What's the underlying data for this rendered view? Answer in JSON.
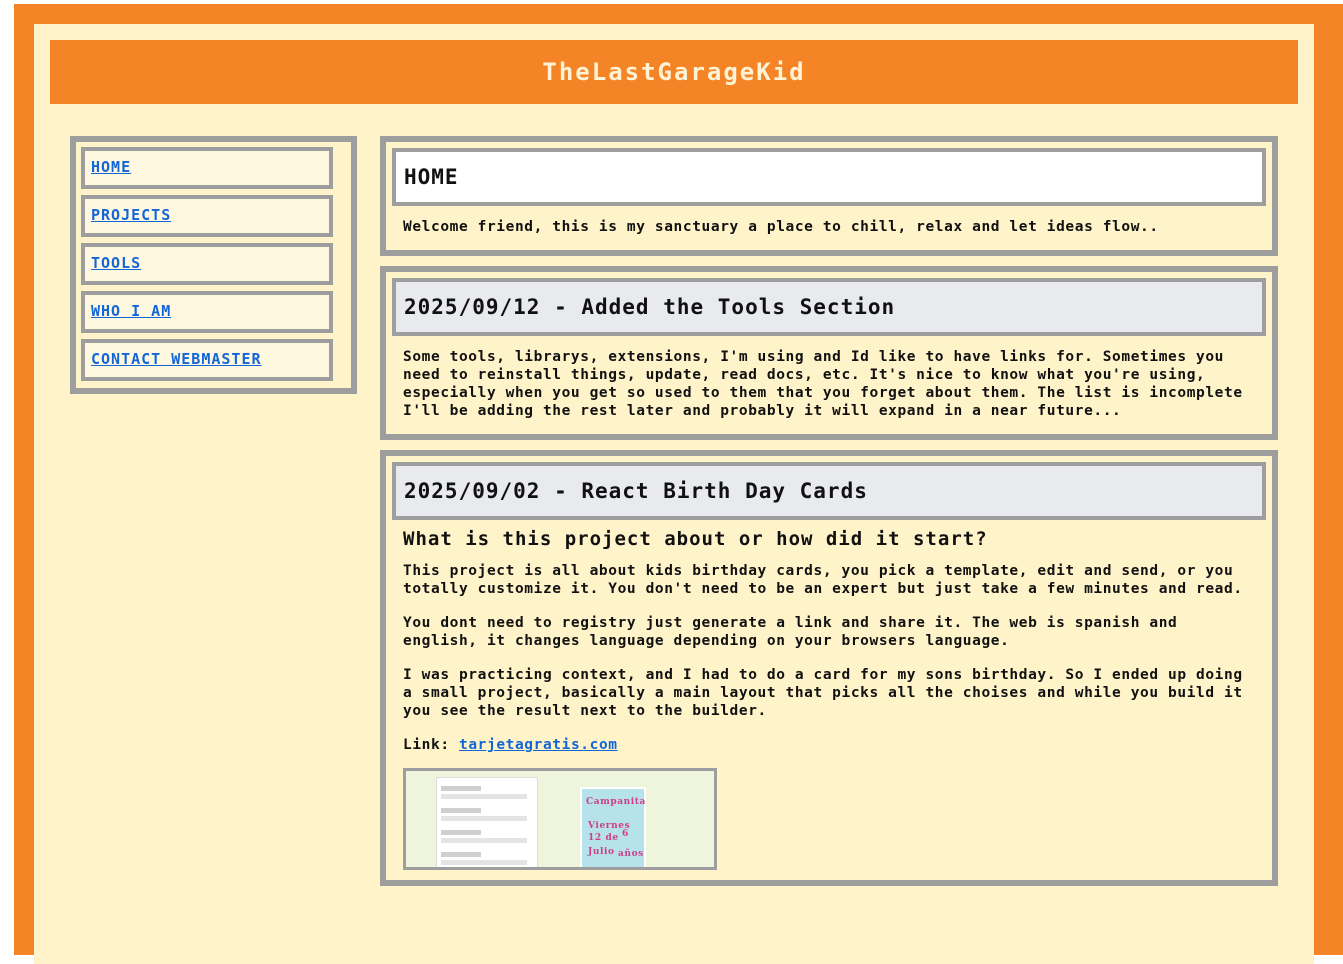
{
  "site": {
    "title": "TheLastGarageKid"
  },
  "nav": {
    "items": [
      {
        "label": "HOME"
      },
      {
        "label": "PROJECTS"
      },
      {
        "label": "TOOLS"
      },
      {
        "label": "WHO I AM"
      },
      {
        "label": "CONTACT WEBMASTER"
      }
    ]
  },
  "posts": [
    {
      "title": "HOME",
      "body": "Welcome friend, this is my sanctuary a place to chill, relax and let ideas flow.."
    },
    {
      "title": "2025/09/12 - Added the Tools Section",
      "body": "Some tools, librarys, extensions, I'm using and Id like to have links for. Sometimes you need to reinstall things, update, read docs, etc. It's nice to know what you're using, especially when you get so used to them that you forget about them. The list is incomplete I'll be adding the rest later and probably it will expand in a near future..."
    },
    {
      "title": "2025/09/02 - React Birth Day Cards",
      "subtitle": "What is this project about or how did it start?",
      "paragraphs": [
        "This project is all about kids birthday cards, you pick a template, edit and send, or you totally customize it. You don't need to be an expert but just take a few minutes and read.",
        "You dont need to registry just generate a link and share it. The web is spanish and english, it changes language depending on your browsers language.",
        "I was practicing context, and I had to do a card for my sons birthday. So I ended up doing a small project, basically a main layout that picks all the choises and while you build it you see the result next to the builder."
      ],
      "link_label": "Link:",
      "link_text": "tarjetagratis.com"
    }
  ],
  "colors": {
    "orange": "#f58426",
    "cream": "#fef3c9",
    "border": "#9e9e9e",
    "link": "#1466d6"
  }
}
